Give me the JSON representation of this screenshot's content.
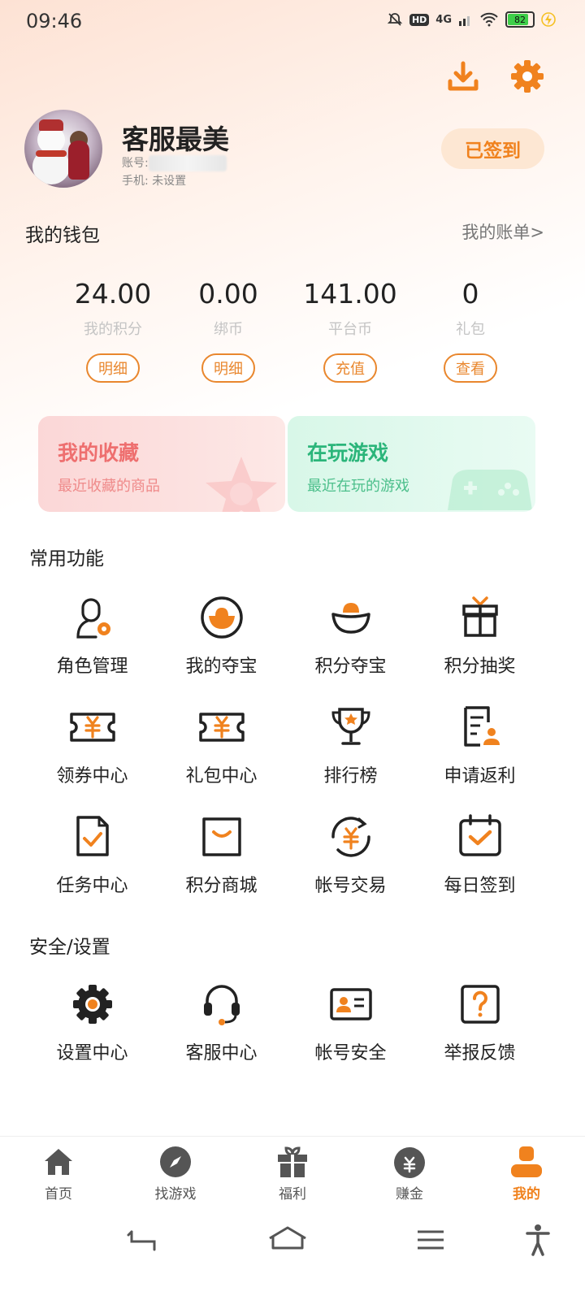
{
  "status_bar": {
    "time": "09:46",
    "network": "4G",
    "battery": "82"
  },
  "profile": {
    "name": "客服最美",
    "account_label": "账号:",
    "phone_label": "手机:",
    "phone_value": "未设置",
    "signin_label": "已签到"
  },
  "wallet": {
    "title": "我的钱包",
    "bill_link": "我的账单>",
    "stats": [
      {
        "value": "24.00",
        "label": "我的积分",
        "action": "明细"
      },
      {
        "value": "0.00",
        "label": "绑币",
        "action": "明细"
      },
      {
        "value": "141.00",
        "label": "平台币",
        "action": "充值"
      },
      {
        "value": "0",
        "label": "礼包",
        "action": "查看"
      }
    ]
  },
  "cards": {
    "favorites": {
      "title": "我的收藏",
      "subtitle": "最近收藏的商品"
    },
    "playing": {
      "title": "在玩游戏",
      "subtitle": "最近在玩的游戏"
    }
  },
  "common": {
    "title": "常用功能",
    "items": [
      {
        "label": "角色管理",
        "icon": "user-gear-icon"
      },
      {
        "label": "我的夺宝",
        "icon": "gold-ingot-circle-icon"
      },
      {
        "label": "积分夺宝",
        "icon": "gold-bowl-icon"
      },
      {
        "label": "积分抽奖",
        "icon": "gift-box-icon"
      },
      {
        "label": "领券中心",
        "icon": "coupon-icon"
      },
      {
        "label": "礼包中心",
        "icon": "gift-coupon-icon"
      },
      {
        "label": "排行榜",
        "icon": "trophy-icon"
      },
      {
        "label": "申请返利",
        "icon": "document-user-icon"
      },
      {
        "label": "任务中心",
        "icon": "task-check-icon"
      },
      {
        "label": "积分商城",
        "icon": "shopping-bag-icon"
      },
      {
        "label": "帐号交易",
        "icon": "exchange-icon"
      },
      {
        "label": "每日签到",
        "icon": "calendar-check-icon"
      }
    ]
  },
  "security": {
    "title": "安全/设置",
    "items": [
      {
        "label": "设置中心",
        "icon": "gear-icon"
      },
      {
        "label": "客服中心",
        "icon": "headset-icon"
      },
      {
        "label": "帐号安全",
        "icon": "id-card-icon"
      },
      {
        "label": "举报反馈",
        "icon": "question-icon"
      }
    ]
  },
  "tabs": [
    {
      "label": "首页",
      "icon": "home-icon"
    },
    {
      "label": "找游戏",
      "icon": "compass-icon"
    },
    {
      "label": "福利",
      "icon": "gift-icon"
    },
    {
      "label": "赚金",
      "icon": "money-bag-icon"
    },
    {
      "label": "我的",
      "icon": "profile-icon",
      "active": true
    }
  ],
  "colors": {
    "accent": "#f0821e",
    "text": "#222222",
    "muted": "#c4c4c4"
  }
}
